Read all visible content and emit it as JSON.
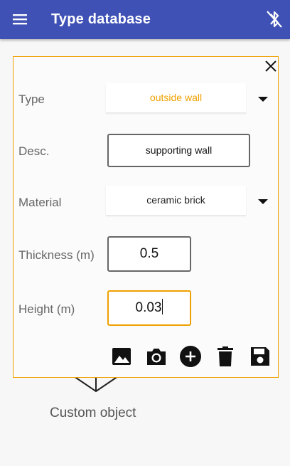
{
  "app_bar": {
    "title": "Type database",
    "menu_icon": "menu-icon",
    "bluetooth_icon": "bluetooth-disabled-icon",
    "color": "#3f51b5"
  },
  "background": {
    "object_label": "Custom object"
  },
  "dialog": {
    "close_icon": "close-icon",
    "border_color": "#f0a000",
    "type": {
      "label": "Type",
      "selected": "outside wall"
    },
    "desc": {
      "label": "Desc.",
      "value": "supporting wall"
    },
    "material": {
      "label": "Material",
      "selected": "ceramic brick"
    },
    "thickness": {
      "label": "Thickness (m)",
      "value": "0.5"
    },
    "height": {
      "label": "Height (m)",
      "value": "0.03"
    },
    "toolbar": {
      "icons": [
        "image-icon",
        "camera-icon",
        "add-circle-icon",
        "delete-icon",
        "save-icon"
      ]
    }
  }
}
